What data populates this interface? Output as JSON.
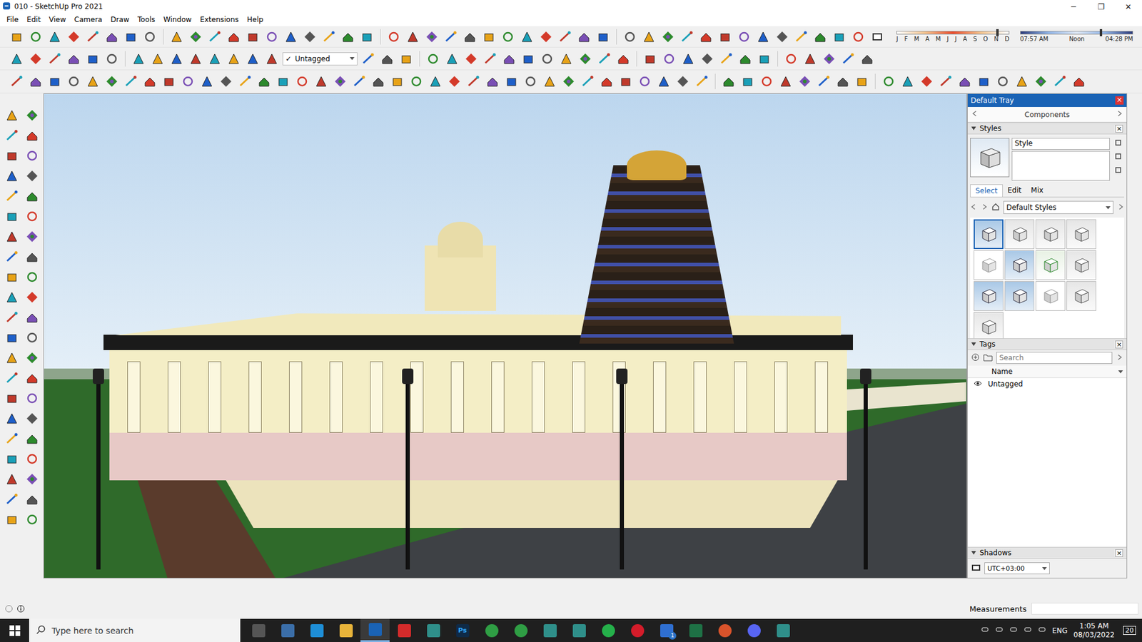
{
  "window": {
    "title": "010 - SketchUp Pro 2021",
    "controls": [
      "─",
      "❐",
      "✕"
    ]
  },
  "menu": [
    "File",
    "Edit",
    "View",
    "Camera",
    "Draw",
    "Tools",
    "Window",
    "Extensions",
    "Help"
  ],
  "toolbar": {
    "tag_dropdown": {
      "check": "✓",
      "value": "Untagged"
    }
  },
  "shadow_settings": {
    "months": [
      "J",
      "F",
      "M",
      "A",
      "M",
      "J",
      "J",
      "A",
      "S",
      "O",
      "N",
      "D"
    ],
    "month_level": 0.9,
    "times": [
      "07:57 AM",
      "Noon",
      "04:28 PM"
    ],
    "time_level": 0.72
  },
  "tray": {
    "title": "Default Tray",
    "close": "×",
    "components": {
      "label": "Components"
    },
    "styles": {
      "label": "Styles",
      "close": "×",
      "name": "Style",
      "tabs": [
        {
          "label": "Select",
          "selected": true
        },
        {
          "label": "Edit",
          "selected": false
        },
        {
          "label": "Mix",
          "selected": false
        }
      ],
      "collection": "Default Styles",
      "thumbnails": [
        {
          "kind": "blue",
          "selected": true
        },
        {
          "kind": "gray",
          "selected": false
        },
        {
          "kind": "gray",
          "selected": false
        },
        {
          "kind": "gray",
          "selected": false
        },
        {
          "kind": "sketch",
          "selected": false
        },
        {
          "kind": "blue",
          "selected": false
        },
        {
          "kind": "green",
          "selected": false
        },
        {
          "kind": "gray",
          "selected": false
        },
        {
          "kind": "blue",
          "selected": false
        },
        {
          "kind": "blue",
          "selected": false
        },
        {
          "kind": "sketch",
          "selected": false
        },
        {
          "kind": "gray",
          "selected": false
        },
        {
          "kind": "gray",
          "selected": false
        }
      ]
    },
    "tags": {
      "label": "Tags",
      "close": "×",
      "search_placeholder": "Search",
      "column": "Name",
      "items": [
        {
          "name": "Untagged",
          "visible": true
        }
      ]
    },
    "shadows": {
      "label": "Shadows",
      "close": "×",
      "timezone": "UTC+03:00"
    }
  },
  "status_bar": {
    "measurements_label": "Measurements"
  },
  "taskbar": {
    "search_placeholder": "Type here to search",
    "apps": [
      {
        "kind": "taskview",
        "active": false,
        "glyph": "",
        "badge": ""
      },
      {
        "kind": "calculator",
        "active": false,
        "glyph": "",
        "badge": ""
      },
      {
        "kind": "edge",
        "active": false,
        "glyph": "",
        "badge": ""
      },
      {
        "kind": "explorer",
        "active": false,
        "glyph": "",
        "badge": ""
      },
      {
        "kind": "sketchup",
        "active": true,
        "glyph": "",
        "badge": ""
      },
      {
        "kind": "acrobat",
        "active": false,
        "glyph": "",
        "badge": ""
      },
      {
        "kind": "app",
        "active": false,
        "glyph": "",
        "badge": ""
      },
      {
        "kind": "photoshop",
        "active": false,
        "glyph": "Ps",
        "badge": ""
      },
      {
        "kind": "chrome",
        "active": false,
        "glyph": "",
        "badge": ""
      },
      {
        "kind": "chrome",
        "active": false,
        "glyph": "",
        "badge": ""
      },
      {
        "kind": "app",
        "active": false,
        "glyph": "",
        "badge": ""
      },
      {
        "kind": "app",
        "active": false,
        "glyph": "",
        "badge": ""
      },
      {
        "kind": "whatsapp",
        "active": false,
        "glyph": "",
        "badge": ""
      },
      {
        "kind": "opera",
        "active": false,
        "glyph": "",
        "badge": ""
      },
      {
        "kind": "todo",
        "active": false,
        "glyph": "",
        "badge": "1"
      },
      {
        "kind": "excel",
        "active": false,
        "glyph": "",
        "badge": ""
      },
      {
        "kind": "grammarly",
        "active": false,
        "glyph": "",
        "badge": ""
      },
      {
        "kind": "discord",
        "active": false,
        "glyph": "",
        "badge": ""
      },
      {
        "kind": "app",
        "active": false,
        "glyph": "",
        "badge": ""
      }
    ],
    "language": "ENG",
    "time": "1:05 AM",
    "date": "08/03/2022",
    "notifications": "20"
  }
}
